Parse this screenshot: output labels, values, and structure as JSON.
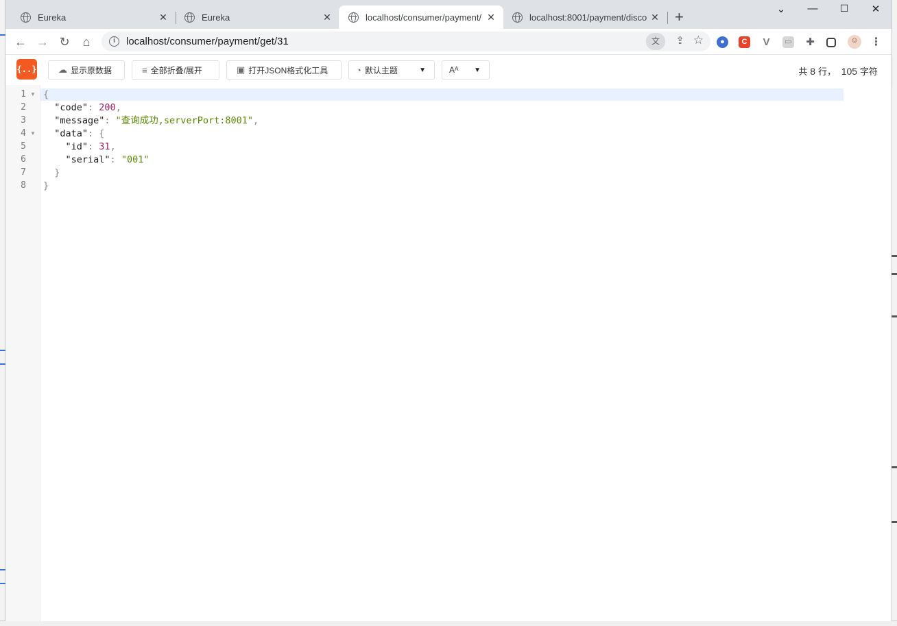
{
  "browser": {
    "tabs": [
      {
        "title": "Eureka"
      },
      {
        "title": "Eureka"
      },
      {
        "title": "localhost/consumer/payment/"
      },
      {
        "title": "localhost:8001/payment/disco"
      }
    ],
    "url": "localhost/consumer/payment/get/31",
    "window_controls": {
      "dropdown": "⌄",
      "minimize": "—",
      "maximize": "☐",
      "close": "✕"
    }
  },
  "json_viewer": {
    "logo": "{..}",
    "buttons": {
      "show_raw": "显示原数据",
      "fold_all": "全部折叠/展开",
      "open_tool": "打开JSON格式化工具",
      "theme": "默认主题",
      "font": "Aᴬ"
    },
    "stats": {
      "prefix": "共",
      "lines": "8",
      "lines_unit": "行，",
      "chars": "105",
      "chars_unit": "字符"
    }
  },
  "json_lines": [
    {
      "num": "1",
      "parts": [
        {
          "t": "{",
          "c": "p"
        }
      ]
    },
    {
      "num": "2",
      "parts": [
        {
          "t": "  \"code\"",
          "c": "k"
        },
        {
          "t": ": ",
          "c": "p"
        },
        {
          "t": "200",
          "c": "n"
        },
        {
          "t": ",",
          "c": "p"
        }
      ]
    },
    {
      "num": "3",
      "parts": [
        {
          "t": "  \"message\"",
          "c": "k"
        },
        {
          "t": ": ",
          "c": "p"
        },
        {
          "t": "\"查询成功,serverPort:8001\"",
          "c": "s"
        },
        {
          "t": ",",
          "c": "p"
        }
      ]
    },
    {
      "num": "4",
      "parts": [
        {
          "t": "  \"data\"",
          "c": "k"
        },
        {
          "t": ": {",
          "c": "p"
        }
      ]
    },
    {
      "num": "5",
      "parts": [
        {
          "t": "    \"id\"",
          "c": "k"
        },
        {
          "t": ": ",
          "c": "p"
        },
        {
          "t": "31",
          "c": "n"
        },
        {
          "t": ",",
          "c": "p"
        }
      ]
    },
    {
      "num": "6",
      "parts": [
        {
          "t": "    \"serial\"",
          "c": "k"
        },
        {
          "t": ": ",
          "c": "p"
        },
        {
          "t": "\"001\"",
          "c": "s"
        }
      ]
    },
    {
      "num": "7",
      "parts": [
        {
          "t": "  }",
          "c": "p"
        }
      ]
    },
    {
      "num": "8",
      "parts": [
        {
          "t": "}",
          "c": "p"
        }
      ]
    }
  ],
  "colors": {
    "logo": "#f25a22",
    "number": "#a31a5e",
    "string": "#5a8a00",
    "active_line": "#e8f2ff"
  }
}
